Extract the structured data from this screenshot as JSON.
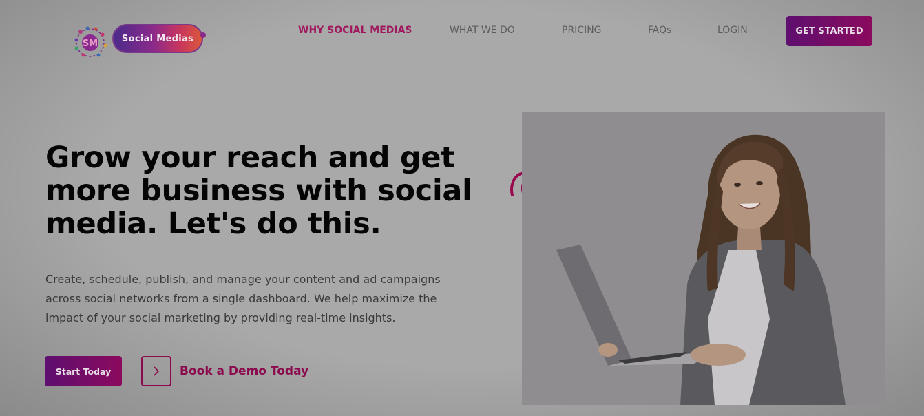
{
  "brand": {
    "logo_text": "Social Medias",
    "logo_monogram": "SM"
  },
  "nav": {
    "items": [
      {
        "label": "WHY SOCIAL MEDIAS",
        "active": true
      },
      {
        "label": "WHAT WE DO",
        "active": false
      },
      {
        "label": "PRICING",
        "active": false
      },
      {
        "label": "FAQs",
        "active": false
      },
      {
        "label": "LOGIN",
        "active": false
      }
    ],
    "cta_label": "GET STARTED"
  },
  "hero": {
    "headline_lines": [
      "Grow your reach and get",
      "more business with social",
      "media. Let's do this."
    ],
    "description_lines": [
      "Create, schedule, publish, and manage your content and ad campaigns",
      "across social networks from a single dashboard. We help maximize the",
      "impact of your social marketing by providing real-time insights."
    ],
    "primary_button": "Start Today",
    "secondary_link": "Book a Demo Today",
    "secondary_icon": "chevron-right-icon"
  },
  "image": {
    "subject": "woman holding laptop",
    "doodle_icon": "curly-arrow-sparkle-icon"
  },
  "colors": {
    "accent": "#8b0a4e",
    "button_gradient_start": "#5e0f6f",
    "button_gradient_end": "#8b0a5e",
    "page_background": "#a9a9a9"
  }
}
